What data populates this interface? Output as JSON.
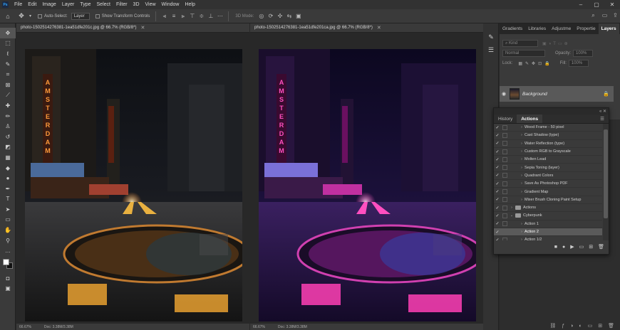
{
  "app": {
    "logo_text": "Ps",
    "menu": [
      "File",
      "Edit",
      "Image",
      "Layer",
      "Type",
      "Select",
      "Filter",
      "3D",
      "View",
      "Window",
      "Help"
    ],
    "window_controls": {
      "minimize": "–",
      "maximize": "▢",
      "close": "✕"
    }
  },
  "options_bar": {
    "auto_select_label": "Auto-Select:",
    "auto_select_value": "Layer",
    "show_transform_label": "Show Transform Controls",
    "mode_label": "3D Mode:"
  },
  "documents": [
    {
      "tab_title": "photo-1502514276381-1ea51dfe201c.jpg @ 66.7% (RGB/8*)",
      "zoom": "66.67%",
      "doc_info": "Doc: 3.38M/3.38M",
      "variant": "warm"
    },
    {
      "tab_title": "photo-1502514276381-1ea51dfe201ca.jpg @ 66.7% (RGB/8*)",
      "zoom": "66.67%",
      "doc_info": "Doc: 3.38M/3.38M",
      "variant": "cyberpunk"
    }
  ],
  "layers_panel": {
    "tabs": [
      "Gradients",
      "Libraries",
      "Adjustme",
      "Propertie",
      "Layers"
    ],
    "active_tab": "Layers",
    "kind_label": "Kind",
    "blend_mode": "Normal",
    "opacity_label": "Opacity:",
    "opacity_value": "100%",
    "lock_label": "Lock:",
    "fill_label": "Fill:",
    "fill_value": "100%",
    "layer_name": "Background"
  },
  "actions_panel": {
    "tabs": [
      "History",
      "Actions"
    ],
    "active_tab": "Actions",
    "items": [
      {
        "label": "Wood Frame - 50 pixel",
        "indent": 0,
        "folder": false,
        "checked": true,
        "selected": false,
        "expanded": false
      },
      {
        "label": "Cast Shadow (type)",
        "indent": 0,
        "folder": false,
        "checked": true,
        "selected": false,
        "expanded": false
      },
      {
        "label": "Water Reflection (type)",
        "indent": 0,
        "folder": false,
        "checked": true,
        "selected": false,
        "expanded": false
      },
      {
        "label": "Custom RGB to Grayscale",
        "indent": 0,
        "folder": false,
        "checked": true,
        "selected": false,
        "expanded": false
      },
      {
        "label": "Molten Lead",
        "indent": 0,
        "folder": false,
        "checked": true,
        "selected": false,
        "expanded": false
      },
      {
        "label": "Sepia Toning (layer)",
        "indent": 0,
        "folder": false,
        "checked": true,
        "selected": false,
        "expanded": false
      },
      {
        "label": "Quadrant Colors",
        "indent": 0,
        "folder": false,
        "checked": true,
        "selected": false,
        "expanded": false
      },
      {
        "label": "Save As Photoshop PDF",
        "indent": 0,
        "folder": false,
        "checked": true,
        "selected": false,
        "expanded": false
      },
      {
        "label": "Gradient Map",
        "indent": 0,
        "folder": false,
        "checked": true,
        "selected": false,
        "expanded": false
      },
      {
        "label": "Mixer Brush Cloning Paint Setup",
        "indent": 0,
        "folder": false,
        "checked": true,
        "selected": false,
        "expanded": false
      },
      {
        "label": "Actions",
        "indent": -1,
        "folder": true,
        "checked": true,
        "selected": false,
        "expanded": false
      },
      {
        "label": "Cyberpunk",
        "indent": -1,
        "folder": true,
        "checked": true,
        "selected": false,
        "expanded": true
      },
      {
        "label": "Action 1",
        "indent": 0,
        "folder": false,
        "checked": true,
        "selected": false,
        "expanded": false
      },
      {
        "label": "Action 2",
        "indent": 0,
        "folder": false,
        "checked": true,
        "selected": true,
        "expanded": false
      },
      {
        "label": "Action 1/2",
        "indent": 0,
        "folder": false,
        "checked": true,
        "selected": false,
        "expanded": false
      }
    ],
    "footer_icons": [
      "stop-icon",
      "record-icon",
      "play-icon",
      "folder-icon",
      "new-action-icon",
      "delete-icon"
    ]
  },
  "tools": [
    "move-tool-icon",
    "marquee-tool-icon",
    "lasso-tool-icon",
    "quick-select-tool-icon",
    "crop-tool-icon",
    "frame-tool-icon",
    "eyedropper-tool-icon",
    "healing-tool-icon",
    "brush-tool-icon",
    "clone-stamp-tool-icon",
    "history-brush-tool-icon",
    "eraser-tool-icon",
    "gradient-tool-icon",
    "blur-tool-icon",
    "dodge-tool-icon",
    "pen-tool-icon",
    "type-tool-icon",
    "path-select-tool-icon",
    "shape-tool-icon",
    "hand-tool-icon",
    "zoom-tool-icon",
    "more-tools-icon"
  ],
  "colors": {
    "accent": "#31a8ff",
    "ui_dark": "#282828",
    "ui_panel": "#3a3a3a",
    "warm_neon": "#ff8a2a",
    "street_yellow": "#e8b040",
    "cyber_pink": "#ff3fb5",
    "cyber_purple": "#6a2ad8"
  }
}
